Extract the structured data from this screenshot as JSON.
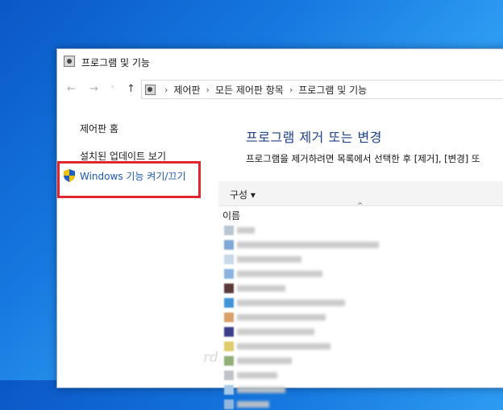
{
  "window": {
    "title": "프로그램 및 기능"
  },
  "nav": {
    "back": "←",
    "forward": "→",
    "recent": "˅",
    "up": "↑"
  },
  "address": {
    "crumbs": [
      "제어판",
      "모든 제어판 항목",
      "프로그램 및 기능"
    ],
    "separator": "›"
  },
  "left_panel": {
    "home": "제어판 홈",
    "updates": "설치된 업데이트 보기",
    "windows_features": "Windows 기능 켜기/끄기"
  },
  "main": {
    "title": "프로그램 제거 또는 변경",
    "description": "프로그램을 제거하려면 목록에서 선택한 후 [제거], [변경] 또",
    "organize": "구성 ▾",
    "column_name": "이름",
    "sort_caret": "^"
  },
  "watermark": "rdsong.com",
  "watermark_ghost": "rd",
  "colors": {
    "highlight": "#e0262e",
    "title_blue": "#1e3f8a",
    "link_blue": "#1a56b0"
  }
}
